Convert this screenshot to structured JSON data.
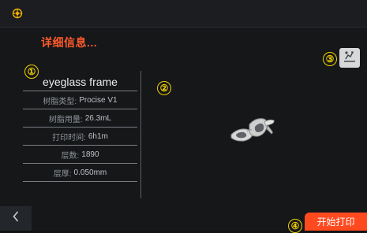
{
  "header": {
    "title": "详细信息..."
  },
  "markers": [
    "①",
    "②",
    "③",
    "④"
  ],
  "model": {
    "name": "eyeglass frame",
    "rows": [
      {
        "label": "树脂类型:",
        "value": "Procise V1"
      },
      {
        "label": "树脂用量:",
        "value": "26.3mL"
      },
      {
        "label": "打印时间:",
        "value": "6h1m"
      },
      {
        "label": "层数:",
        "value": "1890"
      },
      {
        "label": "层厚:",
        "value": "0.050mm"
      }
    ]
  },
  "actions": {
    "start_print_label": "开始打印"
  },
  "icons": {
    "top_left": "settings-icon",
    "print_options": "print-options-icon",
    "back": "chevron-left-icon",
    "preview": "eyeglass-frame-preview-icon"
  },
  "colors": {
    "accent": "#ff4a1f",
    "title": "#ff5a2b",
    "marker": "#f2d000",
    "background": "#151719"
  }
}
